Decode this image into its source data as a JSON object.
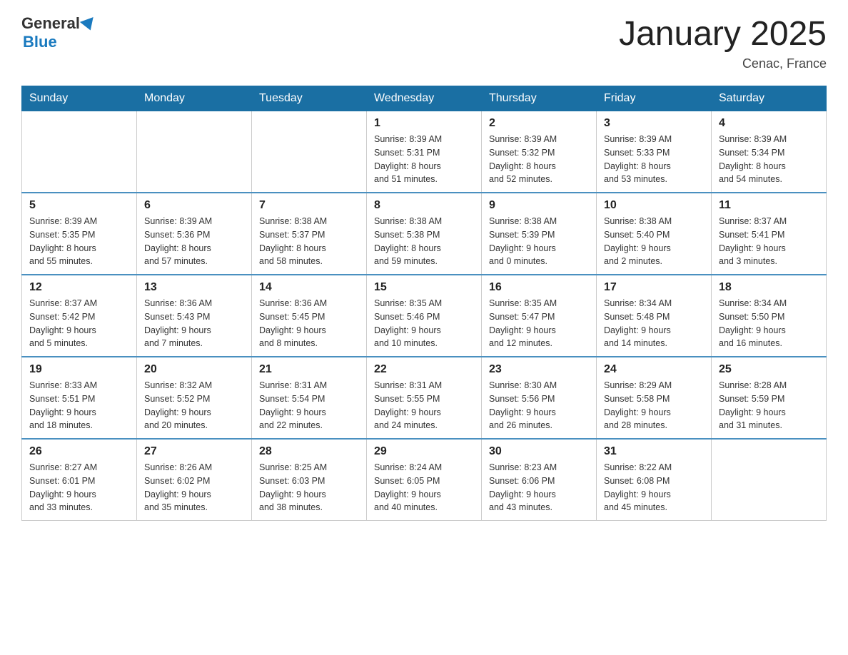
{
  "header": {
    "logo_line1": "General",
    "logo_line2": "Blue",
    "month_title": "January 2025",
    "location": "Cenac, France"
  },
  "weekdays": [
    "Sunday",
    "Monday",
    "Tuesday",
    "Wednesday",
    "Thursday",
    "Friday",
    "Saturday"
  ],
  "weeks": [
    [
      {
        "day": "",
        "info": ""
      },
      {
        "day": "",
        "info": ""
      },
      {
        "day": "",
        "info": ""
      },
      {
        "day": "1",
        "info": "Sunrise: 8:39 AM\nSunset: 5:31 PM\nDaylight: 8 hours\nand 51 minutes."
      },
      {
        "day": "2",
        "info": "Sunrise: 8:39 AM\nSunset: 5:32 PM\nDaylight: 8 hours\nand 52 minutes."
      },
      {
        "day": "3",
        "info": "Sunrise: 8:39 AM\nSunset: 5:33 PM\nDaylight: 8 hours\nand 53 minutes."
      },
      {
        "day": "4",
        "info": "Sunrise: 8:39 AM\nSunset: 5:34 PM\nDaylight: 8 hours\nand 54 minutes."
      }
    ],
    [
      {
        "day": "5",
        "info": "Sunrise: 8:39 AM\nSunset: 5:35 PM\nDaylight: 8 hours\nand 55 minutes."
      },
      {
        "day": "6",
        "info": "Sunrise: 8:39 AM\nSunset: 5:36 PM\nDaylight: 8 hours\nand 57 minutes."
      },
      {
        "day": "7",
        "info": "Sunrise: 8:38 AM\nSunset: 5:37 PM\nDaylight: 8 hours\nand 58 minutes."
      },
      {
        "day": "8",
        "info": "Sunrise: 8:38 AM\nSunset: 5:38 PM\nDaylight: 8 hours\nand 59 minutes."
      },
      {
        "day": "9",
        "info": "Sunrise: 8:38 AM\nSunset: 5:39 PM\nDaylight: 9 hours\nand 0 minutes."
      },
      {
        "day": "10",
        "info": "Sunrise: 8:38 AM\nSunset: 5:40 PM\nDaylight: 9 hours\nand 2 minutes."
      },
      {
        "day": "11",
        "info": "Sunrise: 8:37 AM\nSunset: 5:41 PM\nDaylight: 9 hours\nand 3 minutes."
      }
    ],
    [
      {
        "day": "12",
        "info": "Sunrise: 8:37 AM\nSunset: 5:42 PM\nDaylight: 9 hours\nand 5 minutes."
      },
      {
        "day": "13",
        "info": "Sunrise: 8:36 AM\nSunset: 5:43 PM\nDaylight: 9 hours\nand 7 minutes."
      },
      {
        "day": "14",
        "info": "Sunrise: 8:36 AM\nSunset: 5:45 PM\nDaylight: 9 hours\nand 8 minutes."
      },
      {
        "day": "15",
        "info": "Sunrise: 8:35 AM\nSunset: 5:46 PM\nDaylight: 9 hours\nand 10 minutes."
      },
      {
        "day": "16",
        "info": "Sunrise: 8:35 AM\nSunset: 5:47 PM\nDaylight: 9 hours\nand 12 minutes."
      },
      {
        "day": "17",
        "info": "Sunrise: 8:34 AM\nSunset: 5:48 PM\nDaylight: 9 hours\nand 14 minutes."
      },
      {
        "day": "18",
        "info": "Sunrise: 8:34 AM\nSunset: 5:50 PM\nDaylight: 9 hours\nand 16 minutes."
      }
    ],
    [
      {
        "day": "19",
        "info": "Sunrise: 8:33 AM\nSunset: 5:51 PM\nDaylight: 9 hours\nand 18 minutes."
      },
      {
        "day": "20",
        "info": "Sunrise: 8:32 AM\nSunset: 5:52 PM\nDaylight: 9 hours\nand 20 minutes."
      },
      {
        "day": "21",
        "info": "Sunrise: 8:31 AM\nSunset: 5:54 PM\nDaylight: 9 hours\nand 22 minutes."
      },
      {
        "day": "22",
        "info": "Sunrise: 8:31 AM\nSunset: 5:55 PM\nDaylight: 9 hours\nand 24 minutes."
      },
      {
        "day": "23",
        "info": "Sunrise: 8:30 AM\nSunset: 5:56 PM\nDaylight: 9 hours\nand 26 minutes."
      },
      {
        "day": "24",
        "info": "Sunrise: 8:29 AM\nSunset: 5:58 PM\nDaylight: 9 hours\nand 28 minutes."
      },
      {
        "day": "25",
        "info": "Sunrise: 8:28 AM\nSunset: 5:59 PM\nDaylight: 9 hours\nand 31 minutes."
      }
    ],
    [
      {
        "day": "26",
        "info": "Sunrise: 8:27 AM\nSunset: 6:01 PM\nDaylight: 9 hours\nand 33 minutes."
      },
      {
        "day": "27",
        "info": "Sunrise: 8:26 AM\nSunset: 6:02 PM\nDaylight: 9 hours\nand 35 minutes."
      },
      {
        "day": "28",
        "info": "Sunrise: 8:25 AM\nSunset: 6:03 PM\nDaylight: 9 hours\nand 38 minutes."
      },
      {
        "day": "29",
        "info": "Sunrise: 8:24 AM\nSunset: 6:05 PM\nDaylight: 9 hours\nand 40 minutes."
      },
      {
        "day": "30",
        "info": "Sunrise: 8:23 AM\nSunset: 6:06 PM\nDaylight: 9 hours\nand 43 minutes."
      },
      {
        "day": "31",
        "info": "Sunrise: 8:22 AM\nSunset: 6:08 PM\nDaylight: 9 hours\nand 45 minutes."
      },
      {
        "day": "",
        "info": ""
      }
    ]
  ]
}
